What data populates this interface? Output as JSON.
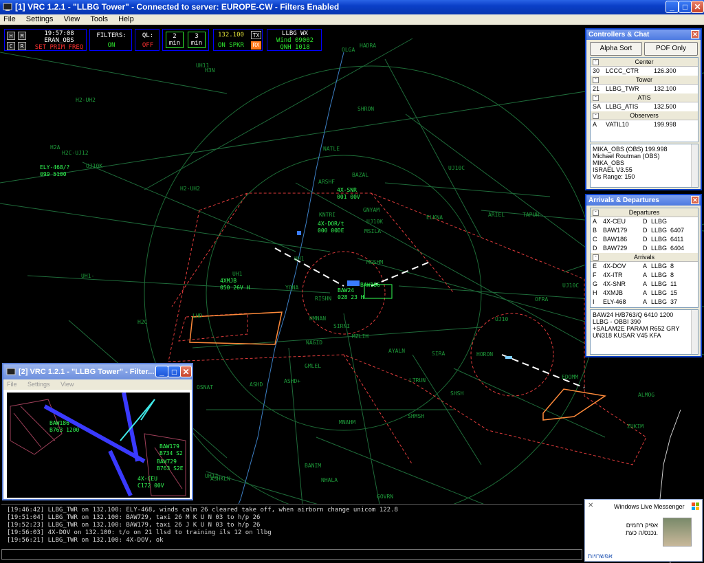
{
  "window": {
    "title": "[1] VRC 1.2.1 - \"LLBG Tower\" - Connected to server: EUROPE-CW - Filters Enabled"
  },
  "menu": [
    "File",
    "Settings",
    "View",
    "Tools",
    "Help"
  ],
  "hud": {
    "btn_h": "H",
    "btn_m": "M",
    "btn_c": "C",
    "btn_r": "R",
    "time": "19:57:08",
    "callsign": "ERAN_OBS",
    "prim_freq": "SET PRIM FREQ",
    "filters_label": "FILTERS:",
    "filters_value": "ON",
    "ql_label": "QL:",
    "ql_value": "OFF",
    "btn1_num": "2",
    "btn1_unit": "min",
    "btn2_num": "3",
    "btn2_unit": "min",
    "freq": "132.100",
    "freq_status": "ON SPKR",
    "tx": "TX",
    "rx": "RX",
    "wx_title": "LLBG WX",
    "wx_wind": "Wind 09002",
    "wx_qnh": "QNH 1018"
  },
  "controllers": {
    "title": "Controllers & Chat",
    "alpha_sort": "Alpha Sort",
    "pof_only": "POF Only",
    "groups": [
      {
        "name": "Center",
        "rows": [
          [
            "30",
            "LCCC_CTR",
            "126.300"
          ]
        ]
      },
      {
        "name": "Tower",
        "rows": [
          [
            "21",
            "LLBG_TWR",
            "132.100"
          ]
        ]
      },
      {
        "name": "ATIS",
        "rows": [
          [
            "SA",
            "LLBG_ATIS",
            "132.500"
          ]
        ]
      },
      {
        "name": "Observers",
        "rows": [
          [
            "A",
            "VATIL10",
            "199.998"
          ]
        ]
      }
    ],
    "info": [
      "MIKA_OBS (OBS) 199.998",
      "Michael Routman (OBS)",
      "MIKA_OBS",
      "ISRAEL V3.55",
      "Vis Range: 150"
    ]
  },
  "arrdep": {
    "title": "Arrivals & Departures",
    "departures_label": "Departures",
    "departures": [
      [
        "A",
        "4X-CEU",
        "D",
        "LLBG",
        ""
      ],
      [
        "B",
        "BAW179",
        "D",
        "LLBG",
        "6407"
      ],
      [
        "C",
        "BAW186",
        "D",
        "LLBG",
        "6411"
      ],
      [
        "D",
        "BAW729",
        "D",
        "LLBG",
        "6404"
      ]
    ],
    "arrivals_label": "Arrivals",
    "arrivals": [
      [
        "E",
        "4X-DOV",
        "A",
        "LLBG",
        "8"
      ],
      [
        "F",
        "4X-ITR",
        "A",
        "LLBG",
        "8"
      ],
      [
        "G",
        "4X-SNR",
        "A",
        "LLBG",
        "11"
      ],
      [
        "H",
        "4XMJB",
        "A",
        "LLBG",
        "15"
      ],
      [
        "I",
        "ELY-468",
        "A",
        "LLBG",
        "37"
      ]
    ],
    "flightplan": [
      "BAW24  H/B763/Q  6410  1200",
      "LLBG - OBBI  390",
      "+SALAM2E PARAM R652 GRY",
      "UN318 KUSAR V45 KFA"
    ]
  },
  "messages": [
    "[19:46:42] LLBG_TWR on 132.100: ELY-468, winds calm 26 cleared take off, when airborn change unicom 122.8",
    "[19:51:04] LLBG_TWR on 132.100: BAW729, taxi 26 M K U N 03 to h/p 26",
    "[19:52:23] LLBG_TWR on 132.100: BAW179, taxi 26 J K U N 03 to h/p 26",
    "[19:56:03] 4X-DOV on 132.100: t/o on 21 llsd to training ils 12 on llbg",
    "[19:56:21] LLBG_TWR on 132.100: 4X-DOV, ok"
  ],
  "mini": {
    "title": "[2] VRC 1.2.1 - \"LLBG Tower\" - Filter...",
    "menu": [
      "File",
      "Settings",
      "View"
    ],
    "tags": [
      {
        "cs": "BAW186",
        "l2": "B763 1200"
      },
      {
        "cs": "BAW179",
        "l2": "B734 S2"
      },
      {
        "cs": "BAW729",
        "l2": "B763 S2E"
      },
      {
        "cs": "4X-CEU",
        "l2": "C172 00V"
      }
    ]
  },
  "messenger": {
    "title": "Windows Live Messenger",
    "line1": "אפיק רחמים",
    "line2": "נכנס/ה כעת.",
    "options": "אפשרויות"
  },
  "traffic": [
    {
      "cs": "ELY-468/?",
      "l2": "099 5100"
    },
    {
      "cs": "4X-SNR",
      "l2": "001 00V"
    },
    {
      "cs": "4X-DOR/t",
      "l2": "000 00DE"
    },
    {
      "cs": "4XMJB",
      "l2": "050 26V H"
    },
    {
      "cs": "BAW186",
      "l2": ""
    },
    {
      "cs": "BAW24",
      "l2": "028 23 H"
    }
  ],
  "fixes": [
    "HADRA",
    "OLGA",
    "UH11",
    "H3N",
    "H2-UH2",
    "SHRON",
    "H2A",
    "H2C-UJ12",
    "UJ10K",
    "NATLE",
    "ARSHF",
    "BAZAL",
    "UJ10C",
    "H2-UH2",
    "KNTRI",
    "GNYAM",
    "ELKNA",
    "ARIEL",
    "TAPUH",
    "MSILA",
    "UJ10K",
    "MGSHM",
    "UH1",
    "UH1-",
    "YONA",
    "UH1",
    "RISHN",
    "OFRA",
    "UJ10C",
    "HMNAN",
    "SIRNI",
    "H2C",
    "LHD",
    "NAGID",
    "MZLIH",
    "AYALN",
    "SIRA",
    "HORON",
    "UJ10",
    "GMLEL",
    "ASHD",
    "ASHD+",
    "LTRUN",
    "EDOMM",
    "OSNAT",
    "SHSH",
    "ALMOG",
    "SHMSH",
    "MNAHM",
    "ZUKIM",
    "BANIM",
    "NHALA",
    "UH12",
    "ASHKLN",
    "GOVRN",
    "NOAMI"
  ]
}
